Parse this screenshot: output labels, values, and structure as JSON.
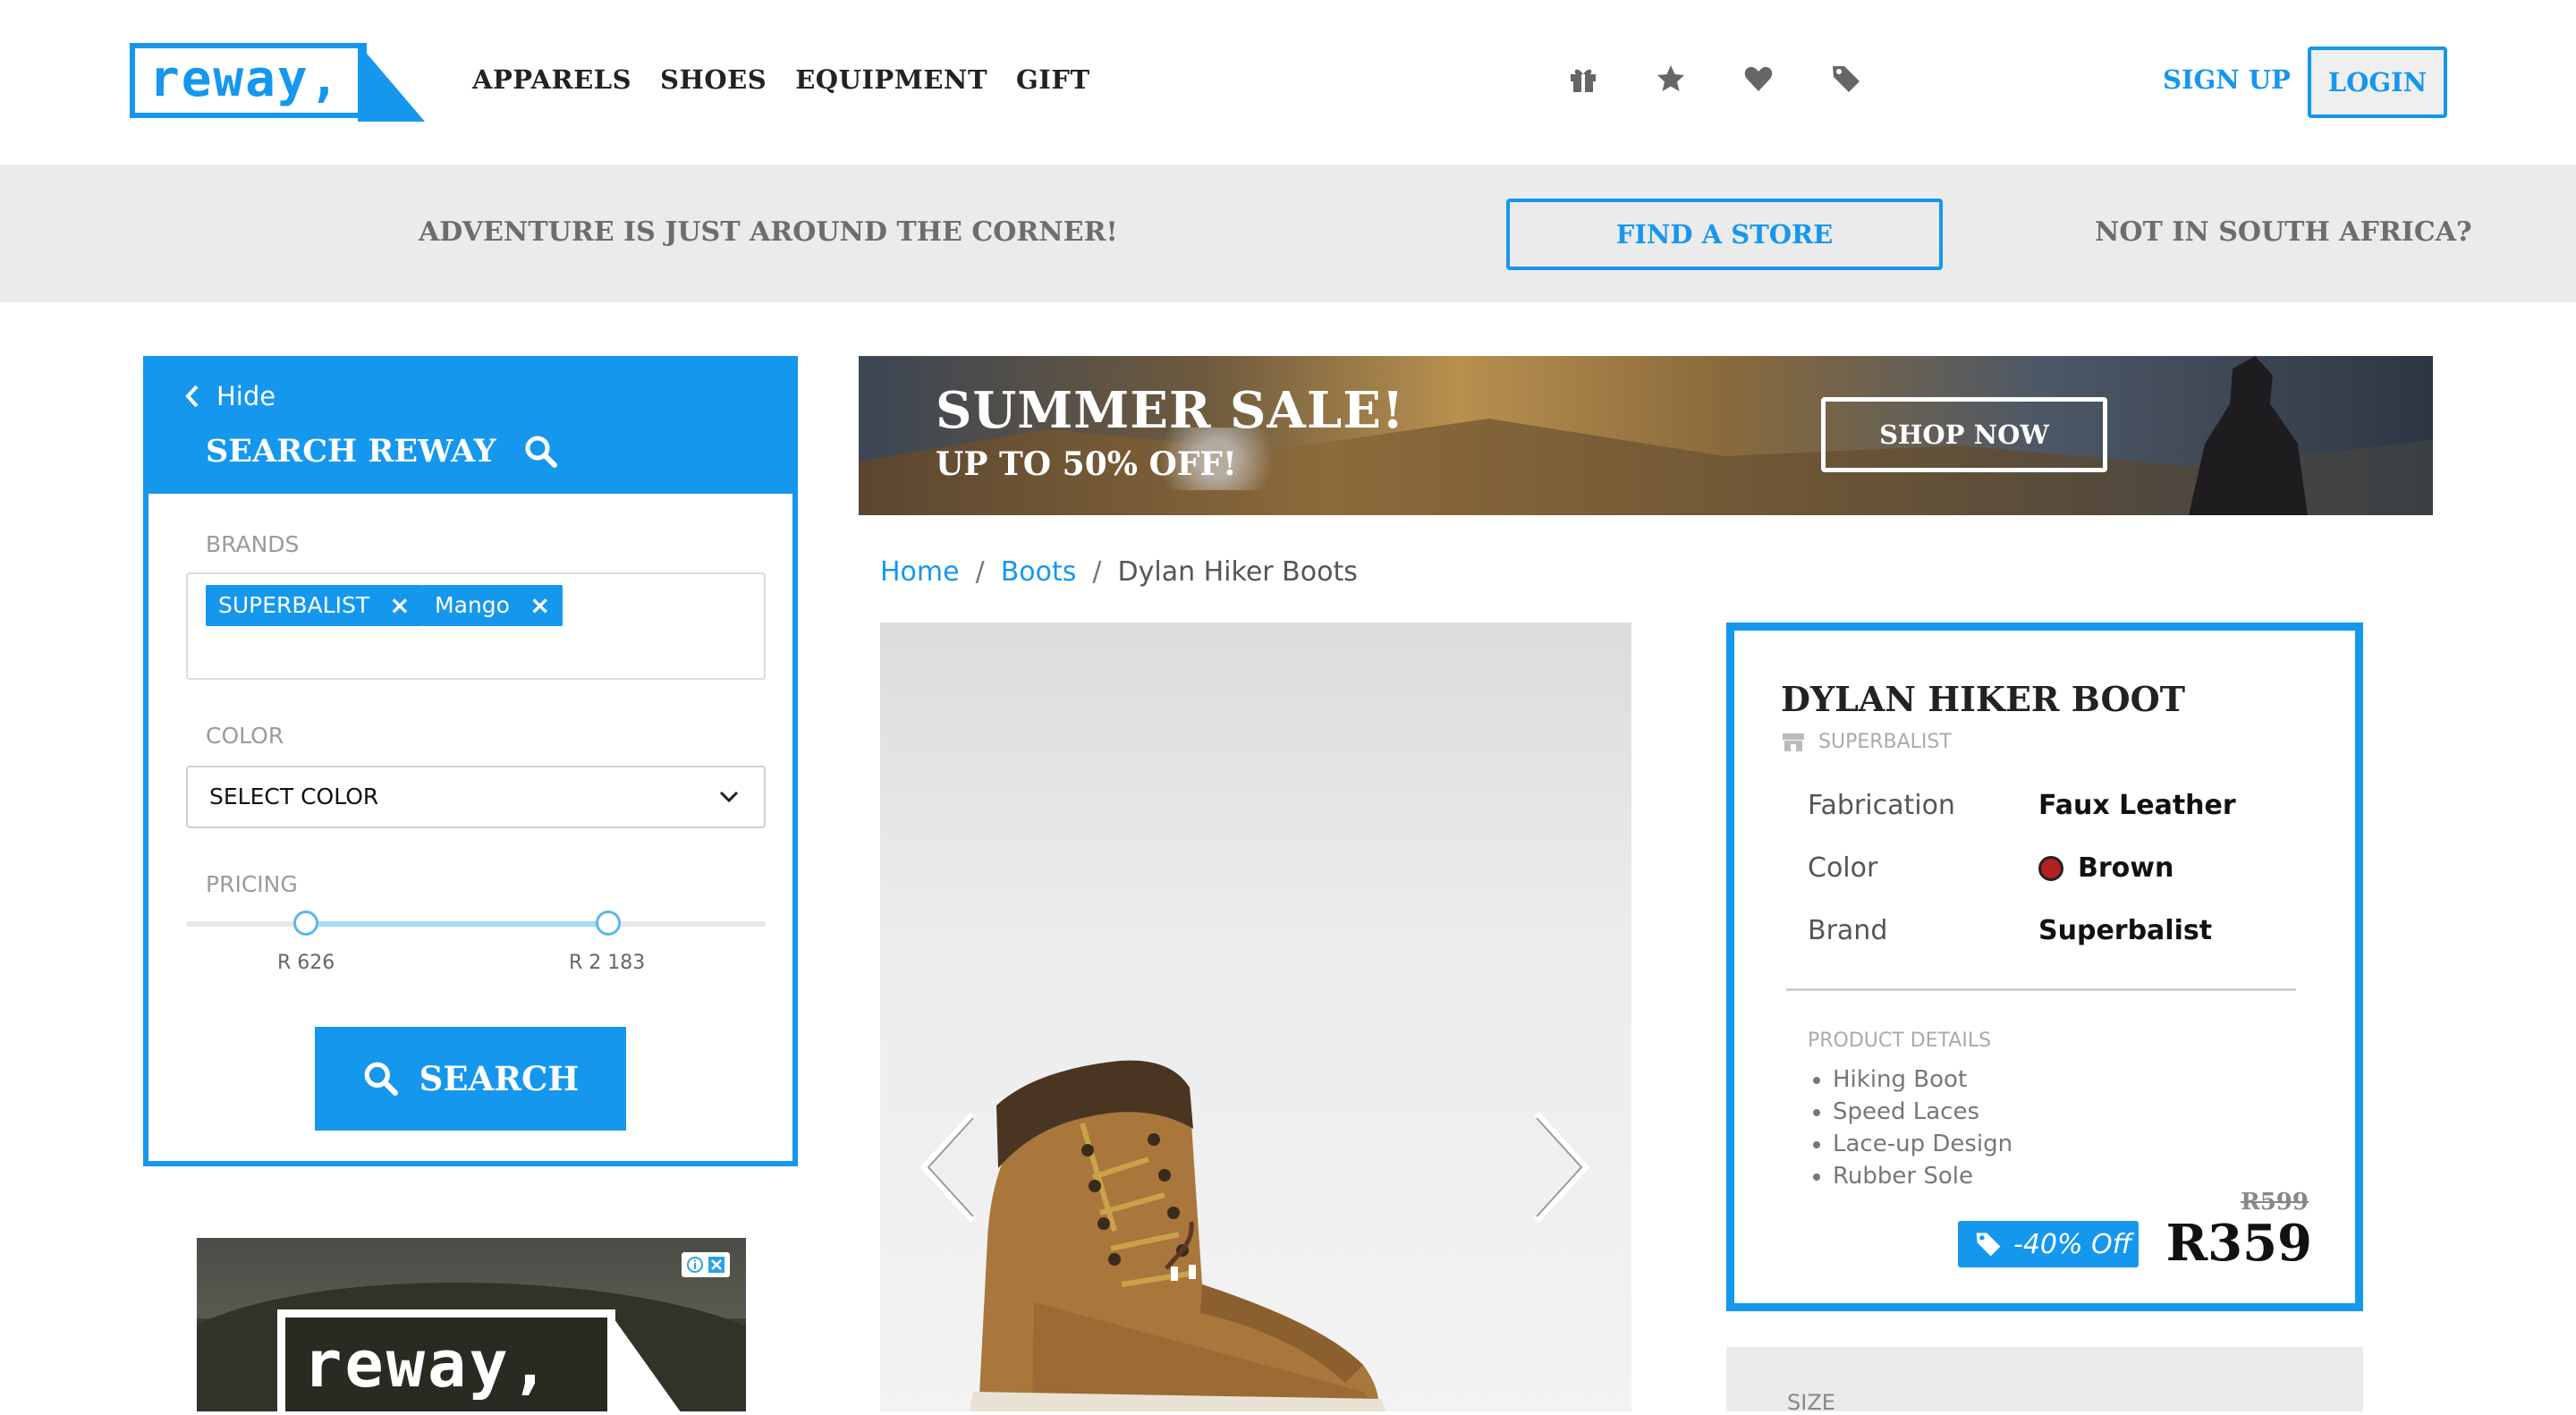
{
  "header": {
    "logo_text": "reway,",
    "nav": [
      "APPARELS",
      "SHOES",
      "EQUIPMENT",
      "GIFT"
    ],
    "icons": [
      "gift-icon",
      "star-icon",
      "heart-icon",
      "tag-icon"
    ],
    "signup_label": "SIGN UP",
    "login_label": "LOGIN"
  },
  "strip": {
    "left_text": "ADVENTURE IS JUST AROUND THE CORNER!",
    "find_store_label": "FIND A STORE",
    "right_text": "NOT IN SOUTH AFRICA?"
  },
  "sidebar": {
    "hide_label": "Hide",
    "title": "SEARCH REWAY",
    "brands_label": "BRANDS",
    "brand_tags": [
      "SUPERBALIST",
      "Mango"
    ],
    "color_label": "COLOR",
    "color_select_value": "SELECT COLOR",
    "pricing_label": "PRICING",
    "price_min": "R 626",
    "price_max": "R 2 183",
    "search_label": "SEARCH"
  },
  "ad": {
    "logo_text": "reway,"
  },
  "banner": {
    "headline": "SUMMER SALE!",
    "subline": "UP TO 50% OFF!",
    "cta_label": "SHOP NOW"
  },
  "breadcrumb": {
    "items": [
      "Home",
      "Boots",
      "Dylan Hiker Boots"
    ],
    "separator": "/"
  },
  "product": {
    "title": "DYLAN HIKER BOOT",
    "brand": "SUPERBALIST",
    "specs": [
      {
        "label": "Fabrication",
        "value": "Faux Leather"
      },
      {
        "label": "Color",
        "value": "Brown"
      },
      {
        "label": "Brand",
        "value": "Superbalist"
      }
    ],
    "color_swatch": "#b22222",
    "details_label": "PRODUCT DETAILS",
    "details": [
      "Hiking Boot",
      "Speed Laces",
      "Lace-up Design",
      "Rubber Sole"
    ],
    "old_price": "R599",
    "discount": "-40% Off",
    "price": "R359"
  },
  "size": {
    "label": "SIZE"
  },
  "colors": {
    "accent": "#1597ee",
    "strip_bg": "#ebebeb"
  }
}
